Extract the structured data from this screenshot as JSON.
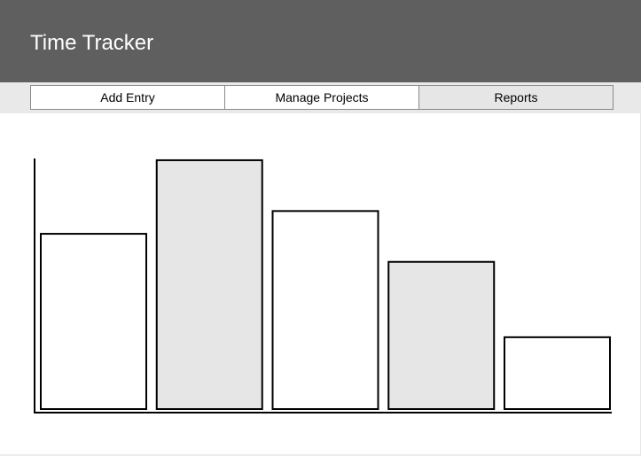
{
  "header": {
    "title": "Time Tracker",
    "background": "#5f5f5f"
  },
  "nav": {
    "tabs": [
      {
        "label": "Add Entry",
        "active": false
      },
      {
        "label": "Manage Projects",
        "active": false
      },
      {
        "label": "Reports",
        "active": true
      }
    ]
  },
  "chart_data": {
    "type": "bar",
    "categories": [
      "",
      "",
      "",
      "",
      ""
    ],
    "values": [
      200,
      284,
      226,
      168,
      82
    ],
    "fills": [
      "#ffffff",
      "#e6e6e6",
      "#ffffff",
      "#e6e6e6",
      "#ffffff"
    ],
    "ylim": [
      0,
      290
    ],
    "title": "",
    "xlabel": "",
    "ylabel": "",
    "grid": false,
    "legend": "none"
  }
}
